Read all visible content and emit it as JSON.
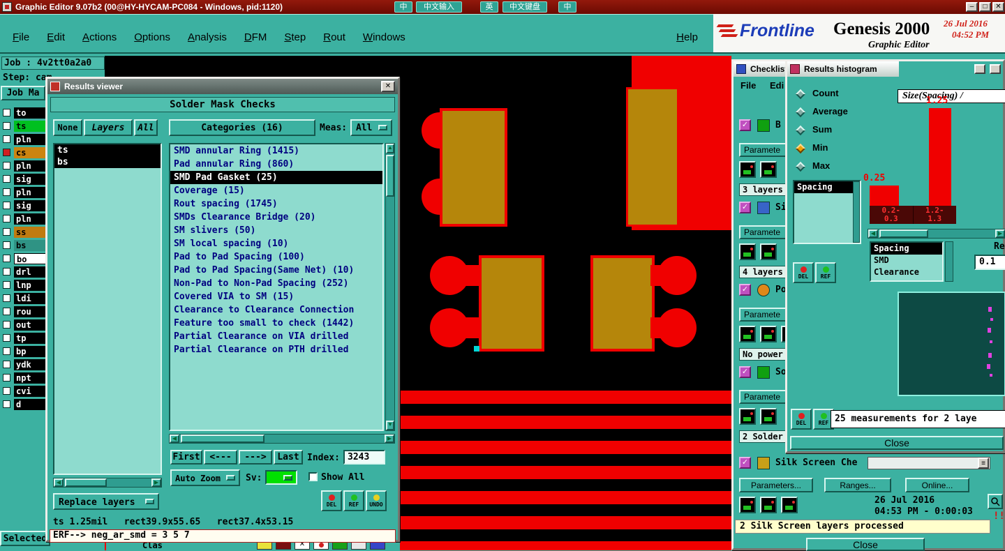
{
  "app": {
    "titlebar": {
      "title": "Graphic Editor 9.07b2 (00@HY-HYCAM-PC084 - Windows, pid:1120)",
      "ime_buttons": [
        "中",
        "中文输入",
        "英",
        "中文键盘",
        "中"
      ],
      "minimize": "–",
      "maximize": "□",
      "close": "✕"
    },
    "menubar": {
      "items": [
        "File",
        "Edit",
        "Actions",
        "Options",
        "Analysis",
        "DFM",
        "Step",
        "Rout",
        "Windows"
      ],
      "help": "Help"
    },
    "branding": {
      "logo": "Frontline",
      "product": "Genesis 2000",
      "date": "26 Jul 2016",
      "time": "04:52 PM",
      "subtitle": "Graphic Editor"
    }
  },
  "job_panel": {
    "job": "Job : 4v2tt0a2a0",
    "step": "Step: cam",
    "tab": "Job Ma",
    "selected_button": "Selected",
    "layers": [
      "to",
      "ts",
      "pln",
      "cs",
      "pln",
      "sig",
      "pln",
      "sig",
      "pln",
      "ss",
      "bs",
      "bo",
      "drl",
      "lnp",
      "ldi",
      "rou",
      "out",
      "tp",
      "bp",
      "ydk",
      "npt",
      "cvi",
      "d"
    ]
  },
  "results_viewer": {
    "title": "Results viewer",
    "close": "✕",
    "header": "Solder Mask Checks",
    "filters": {
      "none": "None",
      "layers": "Layers",
      "all": "All"
    },
    "layer_items": [
      "ts",
      "bs"
    ],
    "categories_label": "Categories (16)",
    "meas_label": "Meas:",
    "meas_value": "All",
    "categories": [
      "SMD annular Ring (1415)",
      "Pad annular Ring (860)",
      "SMD Pad Gasket (25)",
      "Coverage (15)",
      "Rout spacing (1745)",
      "SMDs Clearance Bridge (20)",
      "SM slivers (50)",
      "SM local spacing (10)",
      "Pad to Pad Spacing (100)",
      "Pad to Pad Spacing(Same Net) (10)",
      "Non-Pad to Non-Pad Spacing (252)",
      "Covered VIA to SM (15)",
      "Clearance to Clearance Connection",
      "Feature too small to check (1442)",
      "Partial Clearance on VIA drilled",
      "Partial Clearance on PTH drilled"
    ],
    "selected_category": "SMD Pad Gasket (25)",
    "nav": {
      "first": "First",
      "prev": "<---",
      "next": "--->",
      "last": "Last",
      "index_label": "Index:",
      "index_value": "3243"
    },
    "auto_zoom": "Auto Zoom",
    "sv_label": "Sv:",
    "show_all": "Show All",
    "del": "DEL",
    "ref": "REF",
    "undo": "UNDO",
    "replace_layers": "Replace layers",
    "status_line": "ts 1.25mil   rect39.9x55.65   rect37.4x53.15",
    "erf_line": "ERF--> neg_ar_smd = 3 5 7"
  },
  "checklist": {
    "title": "Checklist",
    "menu_file": "File",
    "menu_edit": "Edi",
    "items": [
      {
        "label": "B",
        "param": "Paramete",
        "status": "3 layers"
      },
      {
        "label": "Si",
        "param": "Paramete",
        "status": "4 layers"
      },
      {
        "label": "Po",
        "param": "Paramete",
        "status": "No power"
      },
      {
        "label": "So",
        "param": "Paramete",
        "status": "2 Solder"
      },
      {
        "label": "Silk Screen Che"
      }
    ],
    "footer": {
      "parameters": "Parameters...",
      "ranges": "Ranges...",
      "online": "Online...",
      "date": "26 Jul 2016",
      "time": "04:53 PM - 0:00:03",
      "processed": "2 Silk Screen layers processed",
      "close": "Close",
      "alert": "!!"
    }
  },
  "histogram": {
    "title": "Results histogram",
    "stats": [
      "Count",
      "Average",
      "Sum",
      "Min",
      "Max"
    ],
    "selected_stat": "Min",
    "chart_title": "Size(Spacing) /",
    "bars": [
      {
        "value": "0.25",
        "range_line1": "0.2-",
        "range_line2": "0.3"
      },
      {
        "value": "1.25",
        "range_line1": "1.2-",
        "range_line2": "1.3"
      }
    ],
    "measure_list": [
      "Spacing"
    ],
    "type_list": [
      "Spacing",
      "SMD",
      "Clearance"
    ],
    "re_label": "Re",
    "threshold": "0.1",
    "measurements": "25 measurements for 2 laye",
    "del": "DEL",
    "ref": "REF",
    "close": "Close"
  },
  "bottom_toolbar": {
    "partial_label": "Clas"
  },
  "chart_data": {
    "type": "bar",
    "title": "Size(Spacing) /",
    "categories": [
      "0.2-0.3",
      "1.2-1.3"
    ],
    "values": [
      0.25,
      1.25
    ],
    "stat": "Min",
    "bar_color": "#ff0000"
  },
  "colors": {
    "titlebar": "#7c1208",
    "teal": "#3cb1a1",
    "canvas": "#000000",
    "pcb_red": "#f00000",
    "pad_olive": "#b5860b",
    "navy_text": "#000080",
    "sv_swatch": "#00e000",
    "highlight_green": "#00c020",
    "highlight_orange": "#cc8410",
    "alert_yellow": "#ffffcc"
  }
}
